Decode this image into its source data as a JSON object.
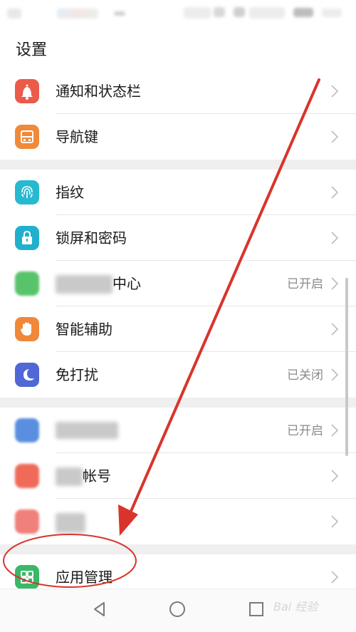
{
  "header": {
    "title": "设置"
  },
  "groups": [
    [
      {
        "key": "notifications",
        "label": "通知和状态栏",
        "status": "",
        "icon": "bell-icon",
        "color": "#ec5a4a"
      },
      {
        "key": "nav-key",
        "label": "导航键",
        "status": "",
        "icon": "nav-key-icon",
        "color": "#f08a3a"
      }
    ],
    [
      {
        "key": "fingerprint",
        "label": "指纹",
        "status": "",
        "icon": "fingerprint-icon",
        "color": "#27b9d0"
      },
      {
        "key": "lock-screen",
        "label": "锁屏和密码",
        "status": "",
        "icon": "lock-icon",
        "color": "#21b0cc"
      },
      {
        "key": "security-center",
        "label": "中心",
        "status": "已开启",
        "icon": "redacted-icon",
        "color": "#57c46b"
      },
      {
        "key": "smart-assist",
        "label": "智能辅助",
        "status": "",
        "icon": "hand-icon",
        "color": "#f0883a"
      },
      {
        "key": "dnd",
        "label": "免打扰",
        "status": "已关闭",
        "icon": "moon-icon",
        "color": "#5067d6"
      }
    ],
    [
      {
        "key": "redacted-1",
        "label": "",
        "status": "已开启",
        "icon": "redacted-icon",
        "color": "#5a8fe0"
      },
      {
        "key": "account",
        "label": "帐号",
        "status": "",
        "icon": "redacted-icon",
        "color": "#f06a5a"
      },
      {
        "key": "redacted-2",
        "label": "",
        "status": "",
        "icon": "redacted-icon",
        "color": "#f0807a"
      }
    ],
    [
      {
        "key": "apps",
        "label": "应用管理",
        "status": "",
        "icon": "apps-grid-icon",
        "color": "#3ab868"
      }
    ]
  ],
  "watermark": "Bai 经验",
  "colors": {
    "annotation": "#d9342b",
    "separator": "#efefef"
  }
}
